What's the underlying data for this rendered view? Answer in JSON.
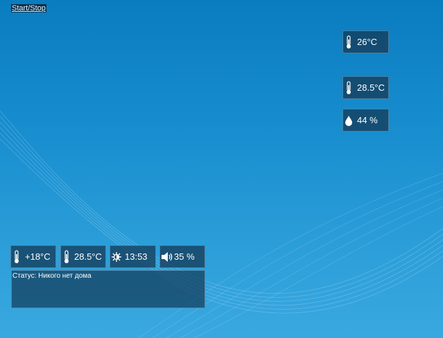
{
  "toolbar": {
    "start_stop_label": "Start/Stop"
  },
  "right_panel": {
    "temp_1": {
      "icon": "thermometer-icon",
      "value": "26°C"
    },
    "temp_2": {
      "icon": "thermometer-icon",
      "value": "28.5°C"
    },
    "humidity": {
      "icon": "water-drop-icon",
      "value": "44 %"
    }
  },
  "bottom_panel": {
    "outdoor_temp": {
      "icon": "thermometer-icon",
      "value": "+18°C"
    },
    "indoor_temp": {
      "icon": "thermometer-icon",
      "value": "28.5°C"
    },
    "time": {
      "icon": "sun-icon",
      "value": "13:53"
    },
    "volume": {
      "icon": "speaker-icon",
      "value": "35 %"
    }
  },
  "status": {
    "text": "Статус: Никого нет дома"
  },
  "colors": {
    "tile_bg": "#143c5a",
    "background": "#1a8ccd",
    "text": "#ffffff"
  }
}
